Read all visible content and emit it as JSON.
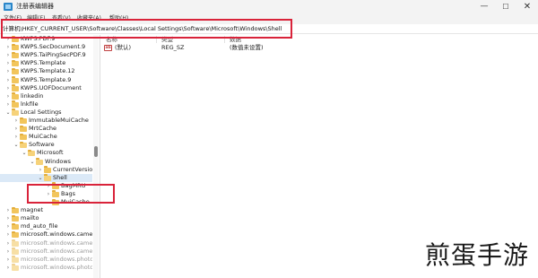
{
  "window": {
    "title": "注册表编辑器",
    "min_glyph": "—",
    "max_glyph": "☐",
    "close_glyph": "✕"
  },
  "menu": [
    "文件(F)",
    "编辑(E)",
    "查看(V)",
    "收藏夹(A)",
    "帮助(H)"
  ],
  "address": "计算机\\HKEY_CURRENT_USER\\Software\\Classes\\Local Settings\\Software\\Microsoft\\Windows\\Shell",
  "tree": [
    {
      "label": "KWPS.PDF.9",
      "expander": "›",
      "open": false,
      "selected": false,
      "faded": false
    },
    {
      "label": "KWPS.SecDocument.9",
      "expander": "›",
      "open": false,
      "selected": false,
      "faded": false
    },
    {
      "label": "KWPS.TaiPingSecPDF.9",
      "expander": "›",
      "open": false,
      "selected": false,
      "faded": false
    },
    {
      "label": "KWPS.Template",
      "expander": "›",
      "open": false,
      "selected": false,
      "faded": false
    },
    {
      "label": "KWPS.Template.12",
      "expander": "›",
      "open": false,
      "selected": false,
      "faded": false
    },
    {
      "label": "KWPS.Template.9",
      "expander": "›",
      "open": false,
      "selected": false,
      "faded": false
    },
    {
      "label": "KWPS.UOFDocument",
      "expander": "›",
      "open": false,
      "selected": false,
      "faded": false
    },
    {
      "label": "linkedin",
      "expander": "›",
      "open": false,
      "selected": false,
      "faded": false
    },
    {
      "label": "lnkfile",
      "expander": "›",
      "open": false,
      "selected": false,
      "faded": false
    },
    {
      "label": "Local Settings",
      "expander": "⌄",
      "open": true,
      "selected": false,
      "faded": false
    },
    {
      "label": "ImmutableMuiCache",
      "expander": "›",
      "open": false,
      "selected": false,
      "faded": false
    },
    {
      "label": "MrtCache",
      "expander": "›",
      "open": false,
      "selected": false,
      "faded": false
    },
    {
      "label": "MuiCache",
      "expander": "›",
      "open": false,
      "selected": false,
      "faded": false
    },
    {
      "label": "Software",
      "expander": "⌄",
      "open": true,
      "selected": false,
      "faded": false
    },
    {
      "label": "Microsoft",
      "expander": "⌄",
      "open": true,
      "selected": false,
      "faded": false
    },
    {
      "label": "Windows",
      "expander": "⌄",
      "open": true,
      "selected": false,
      "faded": false
    },
    {
      "label": "CurrentVersior",
      "expander": "›",
      "open": false,
      "selected": false,
      "faded": false
    },
    {
      "label": "Shell",
      "expander": "⌄",
      "open": true,
      "selected": true,
      "faded": false
    },
    {
      "label": "BagMRU",
      "expander": "›",
      "open": false,
      "selected": false,
      "faded": false
    },
    {
      "label": "Bags",
      "expander": "›",
      "open": false,
      "selected": false,
      "faded": false
    },
    {
      "label": "MuiCache",
      "expander": "",
      "open": false,
      "selected": false,
      "faded": false
    },
    {
      "label": "magnet",
      "expander": "›",
      "open": false,
      "selected": false,
      "faded": false
    },
    {
      "label": "mailto",
      "expander": "›",
      "open": false,
      "selected": false,
      "faded": false
    },
    {
      "label": "md_auto_file",
      "expander": "›",
      "open": false,
      "selected": false,
      "faded": false
    },
    {
      "label": "microsoft.windows.camer",
      "expander": "›",
      "open": false,
      "selected": false,
      "faded": false
    },
    {
      "label": "microsoft.windows.camer",
      "expander": "›",
      "open": false,
      "selected": false,
      "faded": true
    },
    {
      "label": "microsoft.windows.camer",
      "expander": "›",
      "open": false,
      "selected": false,
      "faded": true
    },
    {
      "label": "microsoft.windows.photo",
      "expander": "›",
      "open": false,
      "selected": false,
      "faded": true
    },
    {
      "label": "microsoft.windows.photo",
      "expander": "›",
      "open": false,
      "selected": false,
      "faded": true
    }
  ],
  "values_pane": {
    "headers": {
      "name": "名称",
      "type": "类型",
      "data": "数据"
    },
    "rows": [
      {
        "icon": "ab",
        "name": "(默认)",
        "type": "REG_SZ",
        "data": "(数值未设置)"
      }
    ]
  },
  "watermark": "煎蛋手游",
  "colors": {
    "highlight_box": "#d9233a",
    "selected_row": "#dbe9f7",
    "folder": "#f2c55c"
  }
}
